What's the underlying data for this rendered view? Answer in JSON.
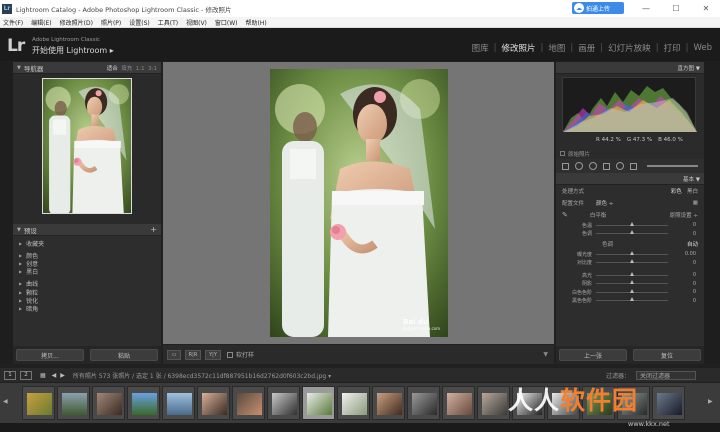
{
  "window": {
    "title": "Lightroom Catalog - Adobe Photoshop Lightroom Classic - 修改照片",
    "cloud_label": "拍通上传",
    "min": "—",
    "max": "☐",
    "close": "✕"
  },
  "menu": [
    "文件(F)",
    "编辑(E)",
    "修改照片(D)",
    "照片(P)",
    "设置(S)",
    "工具(T)",
    "视图(V)",
    "窗口(W)",
    "帮助(H)"
  ],
  "identity": {
    "logo": "Lr",
    "sub": "Adobe Lightroom Classic",
    "title": "开始使用 Lightroom ▸"
  },
  "modules": [
    "图库",
    "修改照片",
    "地图",
    "画册",
    "幻灯片放映",
    "打印",
    "Web"
  ],
  "navigator": {
    "title": "导航器",
    "fit": "适合",
    "fill": "填充",
    "r1": "1:1",
    "r2": "3:1"
  },
  "presets": {
    "title": "预设",
    "items": [
      "收藏夹",
      "颜色",
      "创意",
      "黑白",
      "曲线",
      "颗粒",
      "锐化",
      "暗角"
    ]
  },
  "left_buttons": {
    "copy": "拷贝...",
    "paste": "粘贴"
  },
  "toolbar": {
    "softproof": "软打样"
  },
  "histogram": {
    "title": "直方图",
    "r": "44.2",
    "g": "47.3",
    "b": "46.0",
    "orig": "原始照片"
  },
  "basic": {
    "title": "基本",
    "treatment": "处理方式",
    "color": "彩色",
    "bw": "黑白",
    "profile_label": "配置文件",
    "profile_value": "颜色 ÷",
    "wb_label": "白平衡",
    "wb_value": "原照设置 ÷",
    "temp": "色温",
    "temp_val": "0",
    "tint": "色调",
    "tint_val": "0",
    "tone": "色调",
    "auto": "自动",
    "exposure": "曝光度",
    "exposure_val": "0.00",
    "contrast": "对比度",
    "contrast_val": "0",
    "highlights": "高光",
    "highlights_val": "0",
    "shadows": "阴影",
    "shadows_val": "0",
    "whites": "白色色阶",
    "whites_val": "0",
    "blacks": "黑色色阶",
    "blacks_val": "0"
  },
  "right_buttons": {
    "prev": "上一张",
    "reset": "复位"
  },
  "filmstrip": {
    "p1": "1",
    "p2": "2",
    "info": "所有照片  573 张照片 / 选定 1 张 / 6398ecd3572c11df887951b16d2762d0f603c2bd.jpg ▾",
    "filter_label": "过滤器：",
    "filter_value": "关闭过滤器"
  },
  "watermark": {
    "brand": "Bai du",
    "sub": "jingyan.baidu.com"
  },
  "site_watermark": {
    "cn1": "人人",
    "cn2": "软件园",
    "url": "www.kkx.net"
  }
}
